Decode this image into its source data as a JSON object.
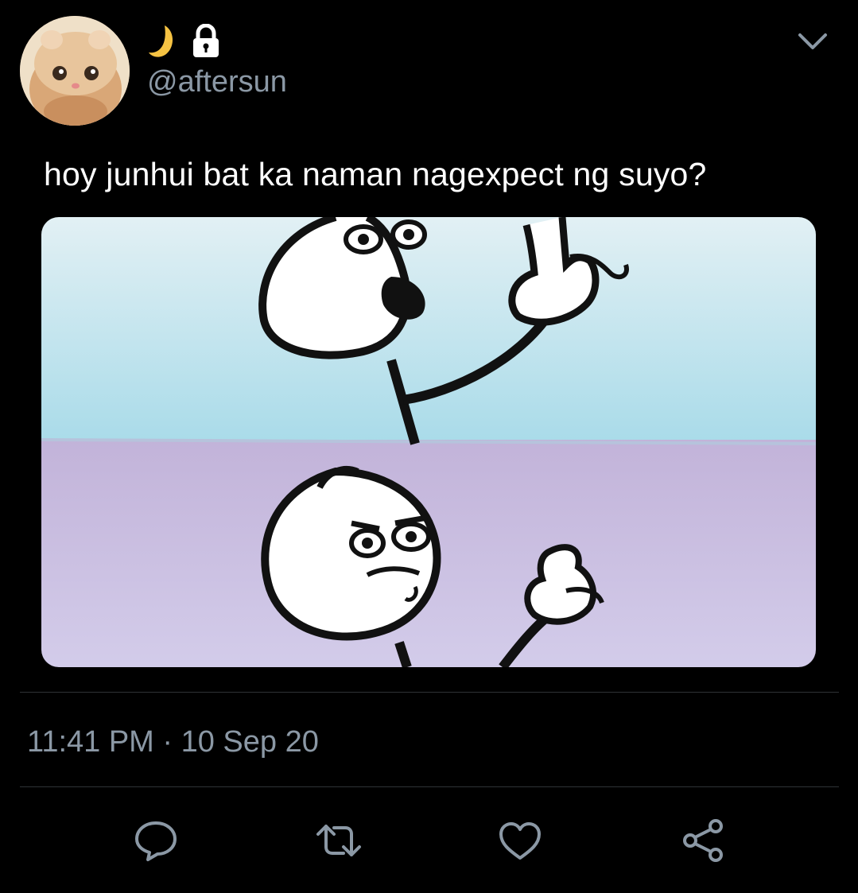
{
  "user": {
    "emoji_moon": "moon-icon",
    "lock": "lock-icon",
    "handle": "@aftersun"
  },
  "tweet": {
    "text": "hoy junhui bat ka naman nagexpect ng suyo?",
    "timestamp": "11:41 PM · 10 Sep 20"
  },
  "actions": {
    "reply": "reply-icon",
    "retweet": "retweet-icon",
    "like": "like-icon",
    "share": "share-icon"
  },
  "colors": {
    "background": "#000000",
    "text": "#ffffff",
    "secondary_text": "#8b98a5",
    "divider": "#2f3336",
    "panel_top": "#cfe6ee",
    "panel_bottom": "#b9acd2"
  }
}
